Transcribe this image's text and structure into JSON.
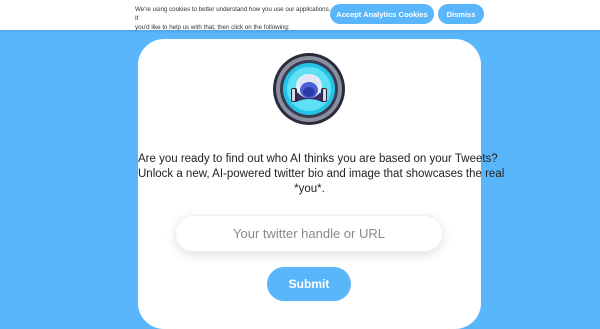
{
  "cookie_banner": {
    "message_line1": "We're using cookies to better understand how you use our applications. If",
    "message_line2": "you'd like to help us with that, then click on the following:",
    "accept_label": "Accept Analytics Cookies",
    "dismiss_label": "Dismiss"
  },
  "main": {
    "logo_icon": "robot-logo-icon",
    "tagline_line1": "Are you ready to find out who AI thinks you are based on your Tweets?",
    "tagline_line2": "Unlock a new, AI-powered twitter bio and image that showcases the real",
    "tagline_line3": "*you*.",
    "handle_input": {
      "value": "",
      "placeholder": "Your twitter handle or URL"
    },
    "submit_label": "Submit"
  },
  "colors": {
    "background": "#5ab6fb",
    "accent": "#5ab6fb",
    "card": "#ffffff"
  }
}
